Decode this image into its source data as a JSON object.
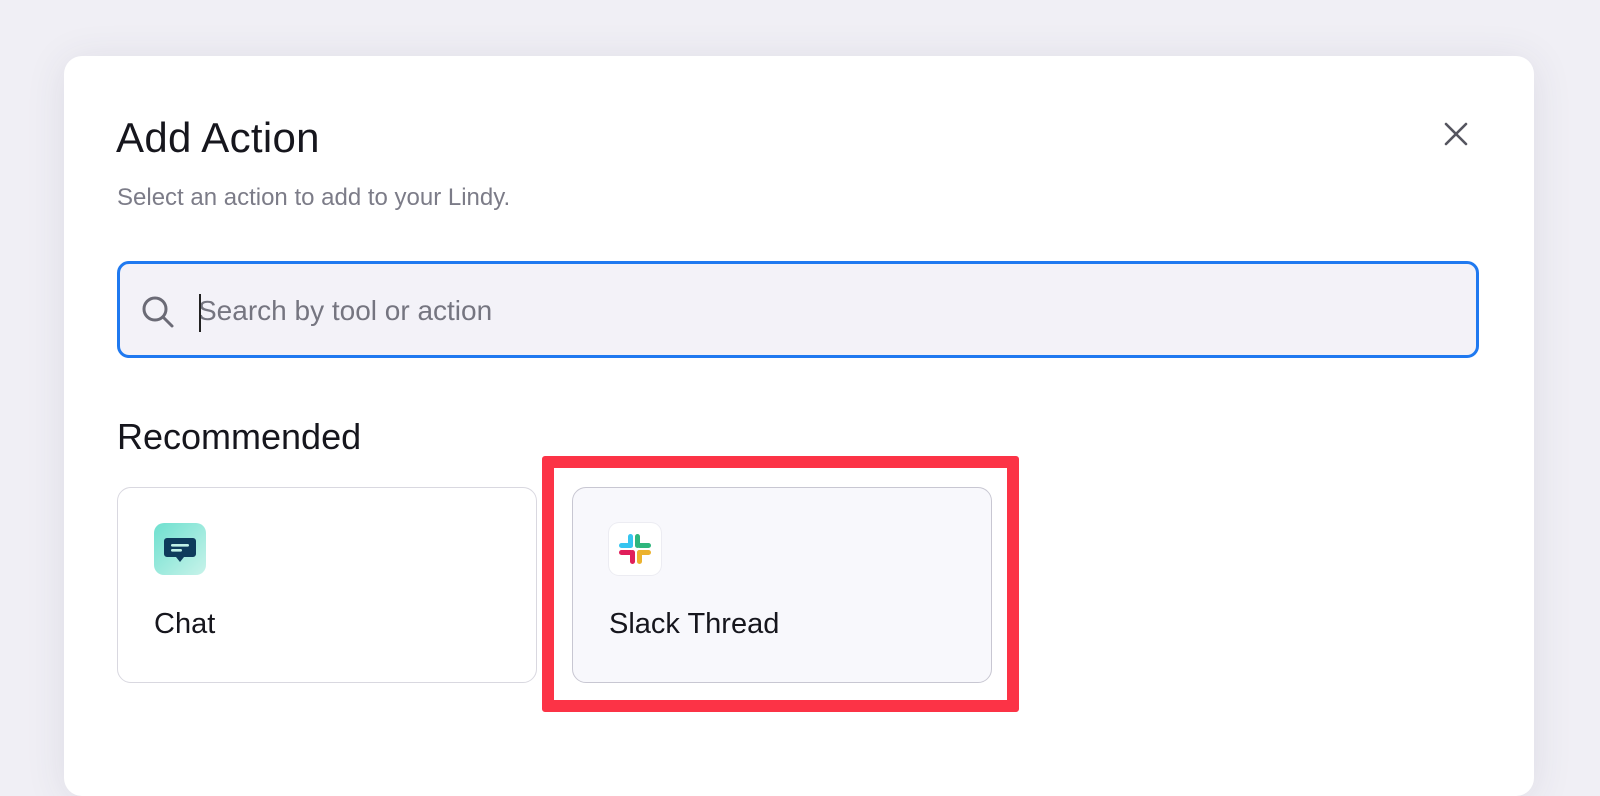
{
  "dialog": {
    "title": "Add Action",
    "subtitle": "Select an action to add to your Lindy.",
    "close_icon": "close-icon"
  },
  "search": {
    "placeholder": "Search by tool or action",
    "value": "",
    "icon": "search-icon",
    "focus_color": "#1f79f0"
  },
  "recommended": {
    "heading": "Recommended",
    "items": [
      {
        "label": "Chat",
        "icon": "chat-bubble-icon",
        "accent": "#0e3b5c"
      },
      {
        "label": "Slack Thread",
        "icon": "slack-logo-icon",
        "accent": "#e01e5a"
      }
    ]
  },
  "annotation": {
    "highlight_color": "#fc3346",
    "highlighted_item": "Slack Thread"
  }
}
